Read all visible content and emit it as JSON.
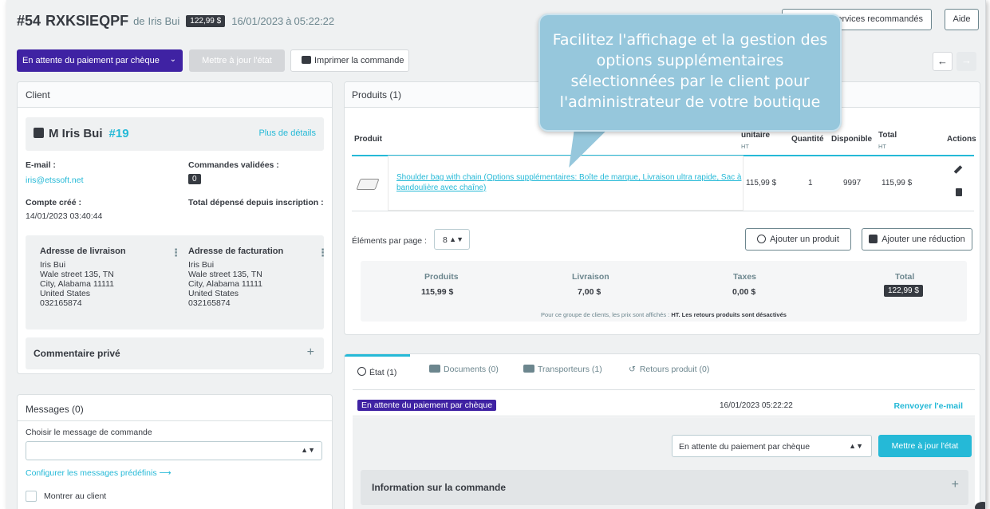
{
  "header": {
    "order_number": "#54",
    "order_reference": "RXKSIEQPF",
    "de": "de",
    "customer_name": "Iris Bui",
    "total_badge": "122,99 $",
    "date": "16/01/2023",
    "a": "à",
    "time": "05:22:22",
    "recommended_button": "services recommandés",
    "help_button": "Aide"
  },
  "actions": {
    "status_dropdown": "En attente du paiement par chèque",
    "update_state": "Mettre à jour l'état",
    "print_order": "Imprimer la commande",
    "prev": "←",
    "next": "→"
  },
  "client": {
    "header": "Client",
    "name": "M Iris Bui",
    "id": "#19",
    "more_details": "Plus de détails",
    "email_label": "E-mail :",
    "email": "iris@etssoft.net",
    "orders_label": "Commandes validées :",
    "orders_count": "0",
    "created_label": "Compte créé :",
    "created": "14/01/2023 03:40:44",
    "spent_label": "Total dépensé depuis inscription :",
    "shipping": {
      "title": "Adresse de livraison",
      "lines": [
        "Iris Bui",
        "Wale street 135, TN",
        "City, Alabama 11111",
        "United States",
        "032165874"
      ]
    },
    "billing": {
      "title": "Adresse de facturation",
      "lines": [
        "Iris Bui",
        "Wale street 135, TN",
        "City, Alabama 11111",
        "United States",
        "032165874"
      ]
    },
    "private_comment": "Commentaire privé"
  },
  "messages": {
    "header": "Messages (0)",
    "choose_label": "Choisir le message de commande",
    "configure_link": "Configurer les messages prédéfinis ⟶",
    "show_customer": "Montrer au client"
  },
  "products": {
    "header": "Produits (1)",
    "columns": {
      "product": "Produit",
      "unit": "unitaire",
      "unit_sub": "HT",
      "quantity": "Quantité",
      "available": "Disponible",
      "total": "Total",
      "total_sub": "HT",
      "actions": "Actions"
    },
    "row": {
      "name": "Shoulder bag with chain (Options supplémentaires: Boîte de marque, Livraison ultra rapide, Sac à bandoulière avec chaîne)",
      "unit_price": "115,99 $",
      "quantity": "1",
      "available": "9997",
      "total": "115,99 $"
    },
    "per_page_label": "Éléments par page :",
    "per_page": "8",
    "add_product": "Ajouter un produit",
    "add_discount": "Ajouter une réduction",
    "totals": {
      "products_label": "Produits",
      "products": "115,99 $",
      "shipping_label": "Livraison",
      "shipping": "7,00 $",
      "taxes_label": "Taxes",
      "taxes": "0,00 $",
      "total_label": "Total",
      "total": "122,99 $"
    },
    "note_prefix": "Pour ce groupe de clients, les prix sont affichés :",
    "note_bold": "HT. Les retours produits sont désactivés"
  },
  "tabs": {
    "items": [
      {
        "label": "État (1)",
        "icon": "history-icon"
      },
      {
        "label": "Documents (0)",
        "icon": "folder-icon"
      },
      {
        "label": "Transporteurs (1)",
        "icon": "truck-icon"
      },
      {
        "label": "Retours produit (0)",
        "icon": "undo-icon"
      }
    ],
    "history_status": "En attente du paiement par chèque",
    "history_date": "16/01/2023 05:22:22",
    "resend_email": "Renvoyer l'e-mail",
    "state_select": "En attente du paiement par chèque",
    "update_button": "Mettre à jour l'état",
    "order_info": "Information sur la commande"
  },
  "callout": {
    "text": "Facilitez l'affichage et la gestion des options supplémentaires sélectionnées par le client pour l'administrateur de votre boutique"
  },
  "colors": {
    "accent": "#25b9d7",
    "status_purple": "#3f22a3",
    "callout": "#96c7dc"
  }
}
